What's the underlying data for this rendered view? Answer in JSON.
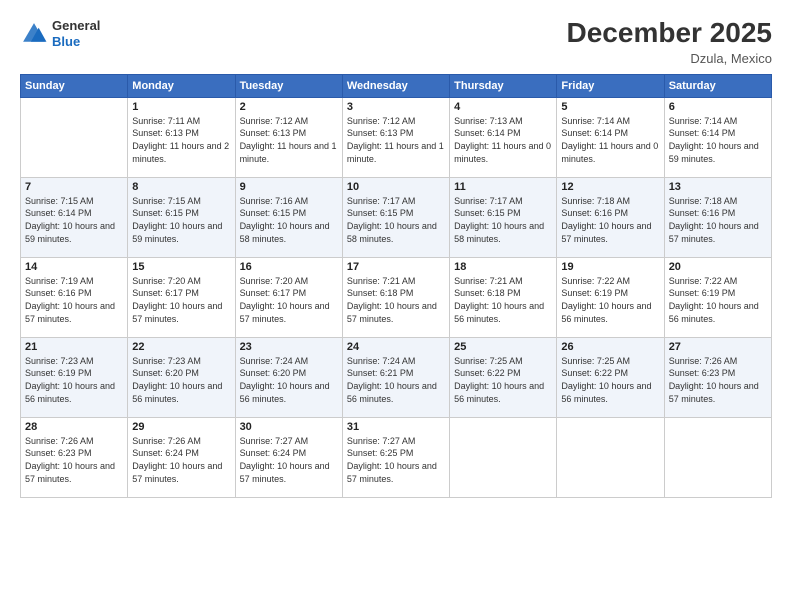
{
  "header": {
    "logo_general": "General",
    "logo_blue": "Blue",
    "month_title": "December 2025",
    "location": "Dzula, Mexico"
  },
  "days_of_week": [
    "Sunday",
    "Monday",
    "Tuesday",
    "Wednesday",
    "Thursday",
    "Friday",
    "Saturday"
  ],
  "weeks": [
    [
      {
        "day": "",
        "sunrise": "",
        "sunset": "",
        "daylight": ""
      },
      {
        "day": "1",
        "sunrise": "Sunrise: 7:11 AM",
        "sunset": "Sunset: 6:13 PM",
        "daylight": "Daylight: 11 hours and 2 minutes."
      },
      {
        "day": "2",
        "sunrise": "Sunrise: 7:12 AM",
        "sunset": "Sunset: 6:13 PM",
        "daylight": "Daylight: 11 hours and 1 minute."
      },
      {
        "day": "3",
        "sunrise": "Sunrise: 7:12 AM",
        "sunset": "Sunset: 6:13 PM",
        "daylight": "Daylight: 11 hours and 1 minute."
      },
      {
        "day": "4",
        "sunrise": "Sunrise: 7:13 AM",
        "sunset": "Sunset: 6:14 PM",
        "daylight": "Daylight: 11 hours and 0 minutes."
      },
      {
        "day": "5",
        "sunrise": "Sunrise: 7:14 AM",
        "sunset": "Sunset: 6:14 PM",
        "daylight": "Daylight: 11 hours and 0 minutes."
      },
      {
        "day": "6",
        "sunrise": "Sunrise: 7:14 AM",
        "sunset": "Sunset: 6:14 PM",
        "daylight": "Daylight: 10 hours and 59 minutes."
      }
    ],
    [
      {
        "day": "7",
        "sunrise": "Sunrise: 7:15 AM",
        "sunset": "Sunset: 6:14 PM",
        "daylight": "Daylight: 10 hours and 59 minutes."
      },
      {
        "day": "8",
        "sunrise": "Sunrise: 7:15 AM",
        "sunset": "Sunset: 6:15 PM",
        "daylight": "Daylight: 10 hours and 59 minutes."
      },
      {
        "day": "9",
        "sunrise": "Sunrise: 7:16 AM",
        "sunset": "Sunset: 6:15 PM",
        "daylight": "Daylight: 10 hours and 58 minutes."
      },
      {
        "day": "10",
        "sunrise": "Sunrise: 7:17 AM",
        "sunset": "Sunset: 6:15 PM",
        "daylight": "Daylight: 10 hours and 58 minutes."
      },
      {
        "day": "11",
        "sunrise": "Sunrise: 7:17 AM",
        "sunset": "Sunset: 6:15 PM",
        "daylight": "Daylight: 10 hours and 58 minutes."
      },
      {
        "day": "12",
        "sunrise": "Sunrise: 7:18 AM",
        "sunset": "Sunset: 6:16 PM",
        "daylight": "Daylight: 10 hours and 57 minutes."
      },
      {
        "day": "13",
        "sunrise": "Sunrise: 7:18 AM",
        "sunset": "Sunset: 6:16 PM",
        "daylight": "Daylight: 10 hours and 57 minutes."
      }
    ],
    [
      {
        "day": "14",
        "sunrise": "Sunrise: 7:19 AM",
        "sunset": "Sunset: 6:16 PM",
        "daylight": "Daylight: 10 hours and 57 minutes."
      },
      {
        "day": "15",
        "sunrise": "Sunrise: 7:20 AM",
        "sunset": "Sunset: 6:17 PM",
        "daylight": "Daylight: 10 hours and 57 minutes."
      },
      {
        "day": "16",
        "sunrise": "Sunrise: 7:20 AM",
        "sunset": "Sunset: 6:17 PM",
        "daylight": "Daylight: 10 hours and 57 minutes."
      },
      {
        "day": "17",
        "sunrise": "Sunrise: 7:21 AM",
        "sunset": "Sunset: 6:18 PM",
        "daylight": "Daylight: 10 hours and 57 minutes."
      },
      {
        "day": "18",
        "sunrise": "Sunrise: 7:21 AM",
        "sunset": "Sunset: 6:18 PM",
        "daylight": "Daylight: 10 hours and 56 minutes."
      },
      {
        "day": "19",
        "sunrise": "Sunrise: 7:22 AM",
        "sunset": "Sunset: 6:19 PM",
        "daylight": "Daylight: 10 hours and 56 minutes."
      },
      {
        "day": "20",
        "sunrise": "Sunrise: 7:22 AM",
        "sunset": "Sunset: 6:19 PM",
        "daylight": "Daylight: 10 hours and 56 minutes."
      }
    ],
    [
      {
        "day": "21",
        "sunrise": "Sunrise: 7:23 AM",
        "sunset": "Sunset: 6:19 PM",
        "daylight": "Daylight: 10 hours and 56 minutes."
      },
      {
        "day": "22",
        "sunrise": "Sunrise: 7:23 AM",
        "sunset": "Sunset: 6:20 PM",
        "daylight": "Daylight: 10 hours and 56 minutes."
      },
      {
        "day": "23",
        "sunrise": "Sunrise: 7:24 AM",
        "sunset": "Sunset: 6:20 PM",
        "daylight": "Daylight: 10 hours and 56 minutes."
      },
      {
        "day": "24",
        "sunrise": "Sunrise: 7:24 AM",
        "sunset": "Sunset: 6:21 PM",
        "daylight": "Daylight: 10 hours and 56 minutes."
      },
      {
        "day": "25",
        "sunrise": "Sunrise: 7:25 AM",
        "sunset": "Sunset: 6:22 PM",
        "daylight": "Daylight: 10 hours and 56 minutes."
      },
      {
        "day": "26",
        "sunrise": "Sunrise: 7:25 AM",
        "sunset": "Sunset: 6:22 PM",
        "daylight": "Daylight: 10 hours and 56 minutes."
      },
      {
        "day": "27",
        "sunrise": "Sunrise: 7:26 AM",
        "sunset": "Sunset: 6:23 PM",
        "daylight": "Daylight: 10 hours and 57 minutes."
      }
    ],
    [
      {
        "day": "28",
        "sunrise": "Sunrise: 7:26 AM",
        "sunset": "Sunset: 6:23 PM",
        "daylight": "Daylight: 10 hours and 57 minutes."
      },
      {
        "day": "29",
        "sunrise": "Sunrise: 7:26 AM",
        "sunset": "Sunset: 6:24 PM",
        "daylight": "Daylight: 10 hours and 57 minutes."
      },
      {
        "day": "30",
        "sunrise": "Sunrise: 7:27 AM",
        "sunset": "Sunset: 6:24 PM",
        "daylight": "Daylight: 10 hours and 57 minutes."
      },
      {
        "day": "31",
        "sunrise": "Sunrise: 7:27 AM",
        "sunset": "Sunset: 6:25 PM",
        "daylight": "Daylight: 10 hours and 57 minutes."
      },
      {
        "day": "",
        "sunrise": "",
        "sunset": "",
        "daylight": ""
      },
      {
        "day": "",
        "sunrise": "",
        "sunset": "",
        "daylight": ""
      },
      {
        "day": "",
        "sunrise": "",
        "sunset": "",
        "daylight": ""
      }
    ]
  ]
}
